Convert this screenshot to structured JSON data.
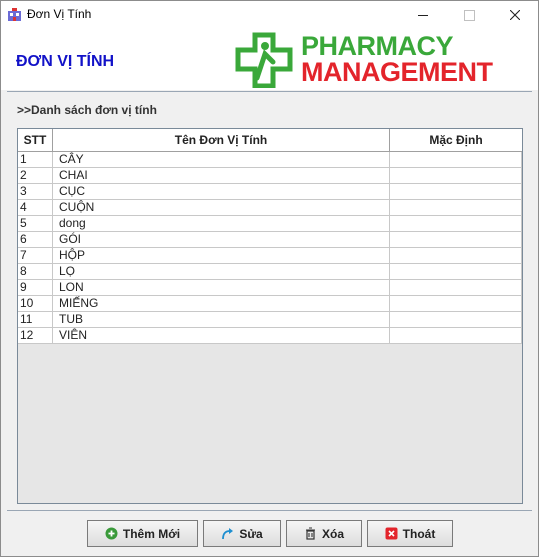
{
  "window": {
    "title": "Đơn Vị Tính"
  },
  "header": {
    "form_title": "ĐƠN VỊ TÍNH",
    "logo_line1": "PHARMACY",
    "logo_line2": "MANAGEMENT"
  },
  "section": {
    "title": ">>Danh sách đơn vị tính"
  },
  "table": {
    "columns": [
      "STT",
      "Tên Đơn Vị Tính",
      "Mặc Định"
    ],
    "rows": [
      {
        "stt": "1",
        "name": "CÂY",
        "default": ""
      },
      {
        "stt": "2",
        "name": "CHAI",
        "default": ""
      },
      {
        "stt": "3",
        "name": "CỤC",
        "default": ""
      },
      {
        "stt": "4",
        "name": "CUỘN",
        "default": ""
      },
      {
        "stt": "5",
        "name": "dong",
        "default": ""
      },
      {
        "stt": "6",
        "name": "GÓI",
        "default": ""
      },
      {
        "stt": "7",
        "name": "HỘP",
        "default": ""
      },
      {
        "stt": "8",
        "name": "LỌ",
        "default": ""
      },
      {
        "stt": "9",
        "name": "LON",
        "default": ""
      },
      {
        "stt": "10",
        "name": "MIẾNG",
        "default": ""
      },
      {
        "stt": "11",
        "name": "TUB",
        "default": ""
      },
      {
        "stt": "12",
        "name": "VIÊN",
        "default": ""
      }
    ]
  },
  "buttons": {
    "add": "Thêm Mới",
    "edit": "Sửa",
    "delete": "Xóa",
    "exit": "Thoát"
  },
  "colors": {
    "title_blue": "#1212c8",
    "logo_green": "#3aa83a",
    "logo_red": "#e3242b"
  }
}
